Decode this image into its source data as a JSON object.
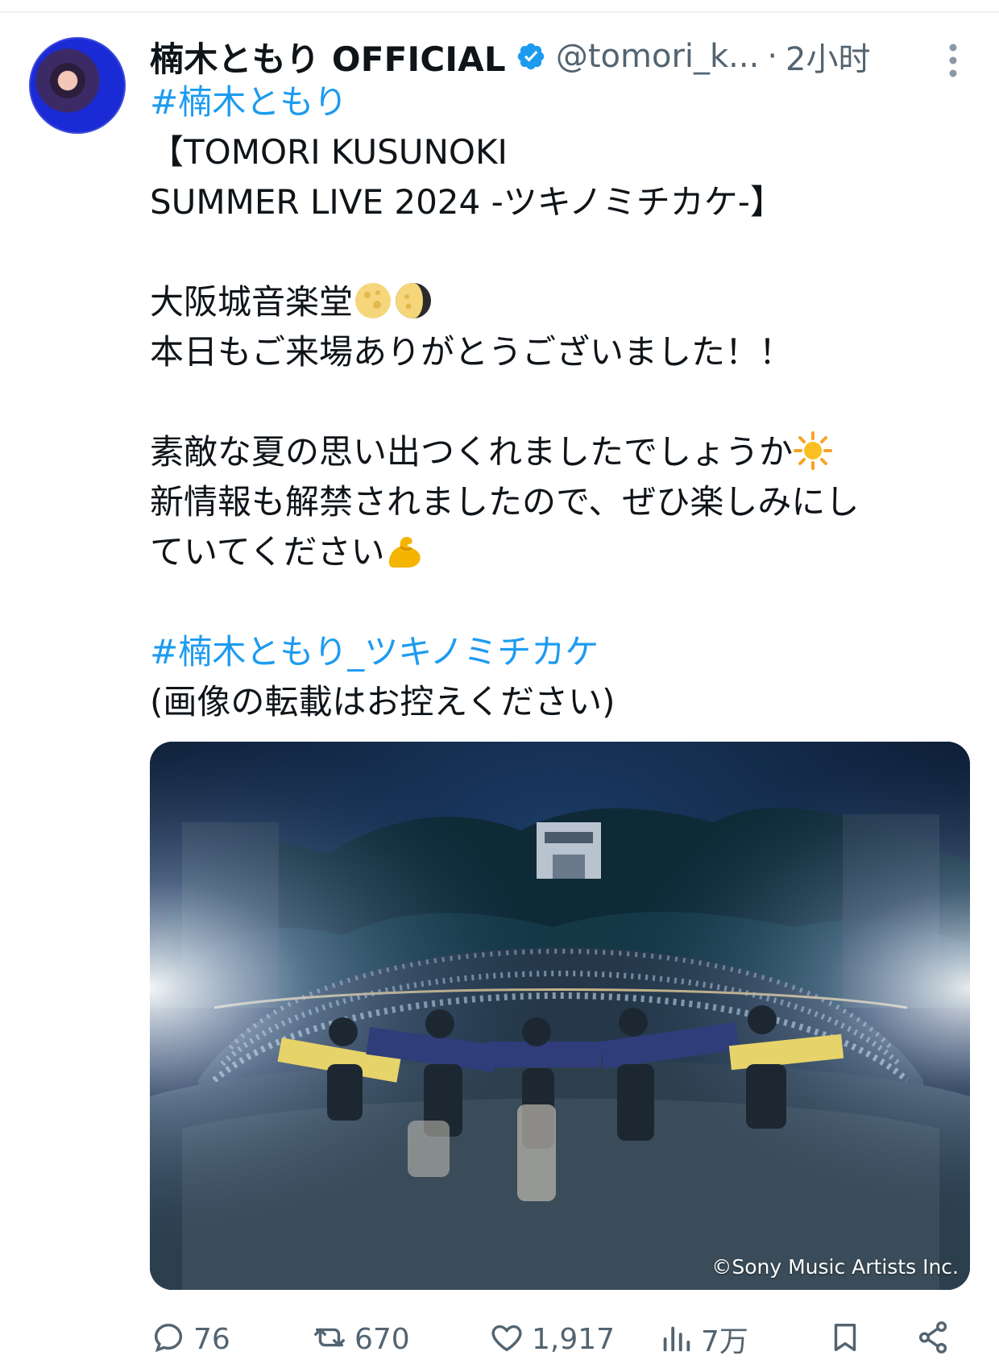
{
  "post": {
    "author_name": "楠木ともり OFFICIAL",
    "handle": "@tomori_k...",
    "separator": "·",
    "time": "2小时",
    "hashtag_top": "#楠木ともり",
    "lines": [
      "【TOMORI KUSUNOKI",
      "SUMMER LIVE 2024 -ツキノミチカケ-】",
      "",
      "大阪城音楽堂",
      "本日もご来場ありがとうございました！！",
      "",
      "素敵な夏の思い出つくれましたでしょうか",
      "新情報も解禁されましたので、ぜひ楽しみにし",
      "ていてください",
      ""
    ],
    "hashtag_bottom": "#楠木ともり_ツキノミチカケ",
    "note": "(画像の転載はお控えください)",
    "image_credit": "©Sony Music Artists Inc."
  },
  "actions": {
    "replies": "76",
    "reposts": "670",
    "likes": "1,917",
    "views": "7万"
  },
  "colors": {
    "accent": "#1d9bf0",
    "secondary_text": "#536471",
    "text": "#0f1419"
  }
}
